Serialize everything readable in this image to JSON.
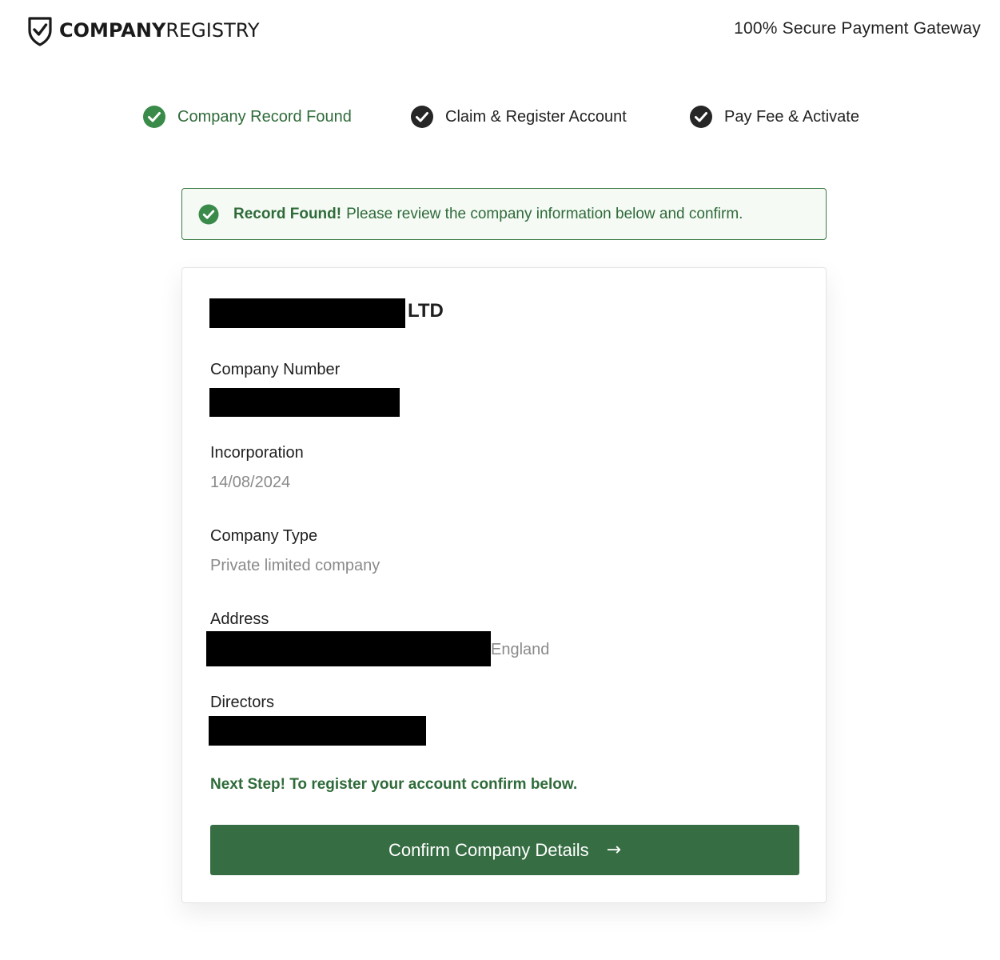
{
  "header": {
    "logo_strong": "COMPANY",
    "logo_light": "REGISTRY",
    "secure_text": "100% Secure Payment Gateway"
  },
  "steps": [
    {
      "label": "Company Record Found",
      "icon": "check-circle-icon",
      "color": "#2f6b3a"
    },
    {
      "label": "Claim & Register Account",
      "icon": "check-circle-icon",
      "color": "#222222"
    },
    {
      "label": "Pay Fee & Activate",
      "icon": "check-circle-icon",
      "color": "#222222"
    }
  ],
  "alert": {
    "bold": "Record Found!",
    "text": "Please review the company information below and confirm."
  },
  "company": {
    "name_suffix": "LTD",
    "fields": {
      "number_label": "Company Number",
      "incorporation_label": "Incorporation",
      "incorporation_value": "14/08/2024",
      "type_label": "Company Type",
      "type_value": "Private limited company",
      "address_label": "Address",
      "address_suffix": "England",
      "directors_label": "Directors"
    }
  },
  "next_step": "Next Step! To register your account confirm below.",
  "confirm_button": {
    "label": "Confirm Company Details",
    "icon": "arrow-right-icon"
  },
  "colors": {
    "brand_green": "#366d43",
    "text_green": "#2f6b3a",
    "alert_bg": "#f5faf5"
  }
}
